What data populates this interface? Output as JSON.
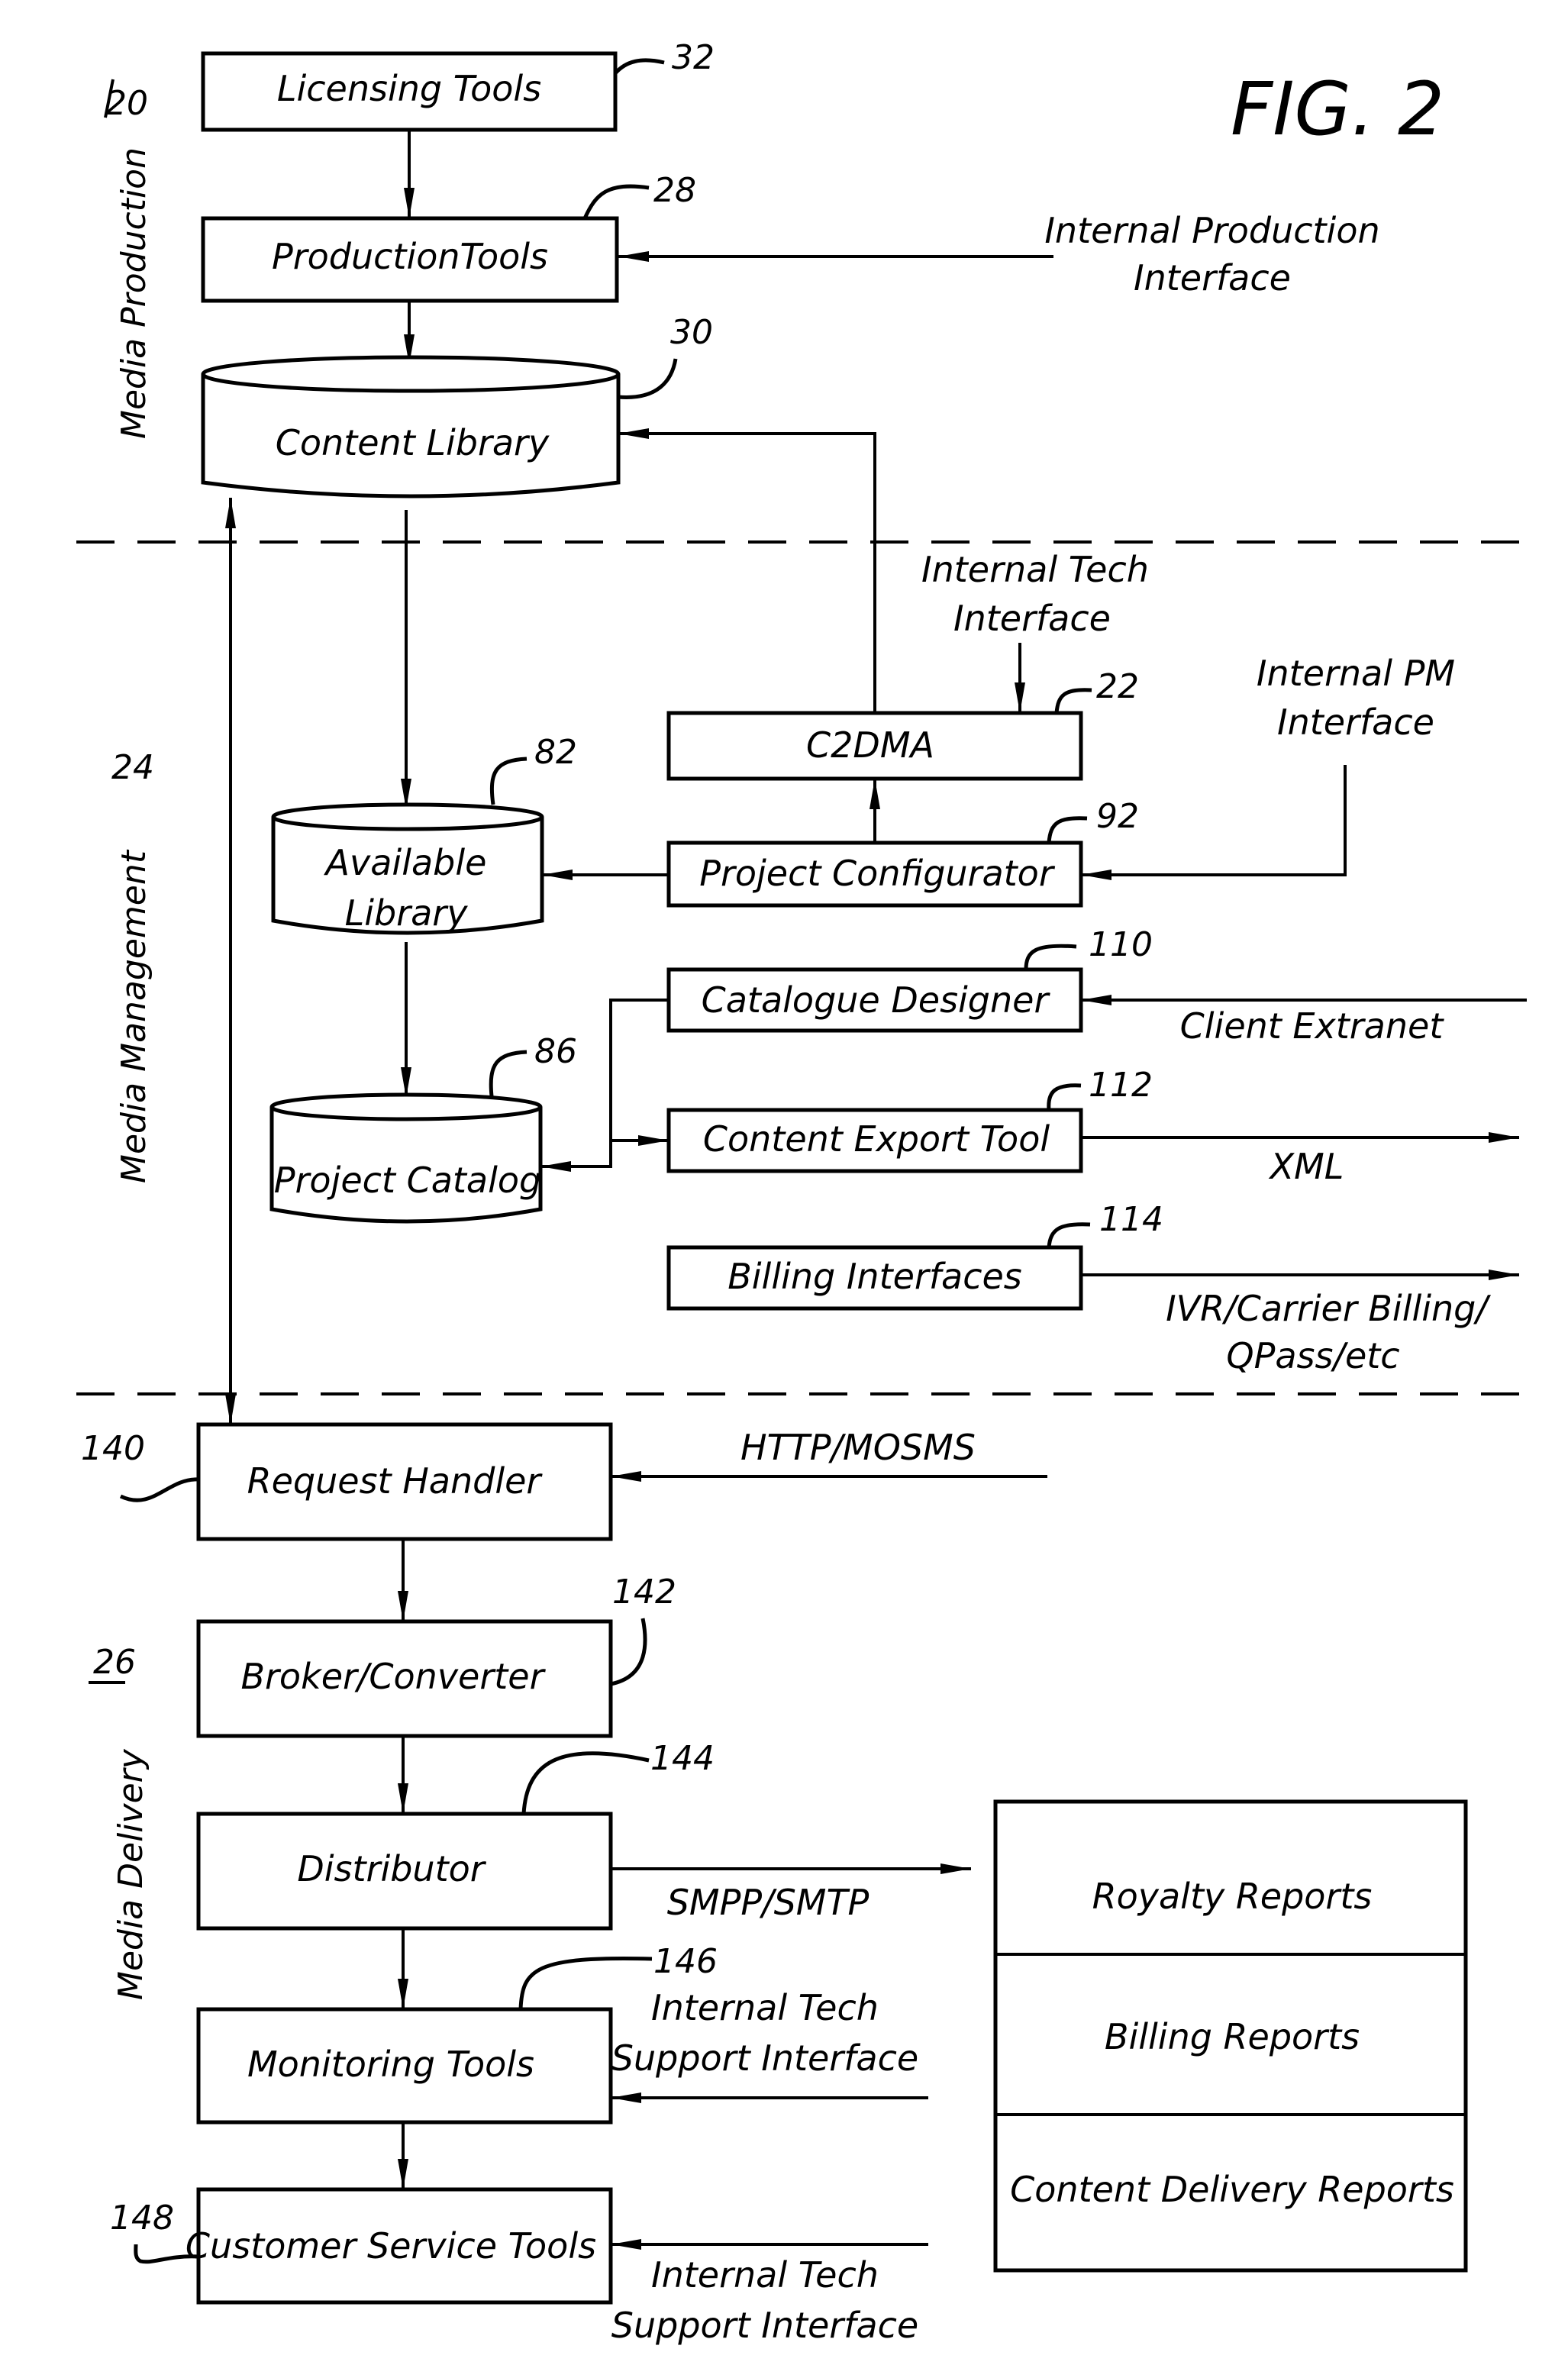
{
  "figure": {
    "title": "FIG. 2"
  },
  "sections": [
    {
      "id": "media-production",
      "label": "Media Production",
      "ref": "20"
    },
    {
      "id": "media-management",
      "label": "Media Management",
      "ref": "24"
    },
    {
      "id": "media-delivery",
      "label": "Media Delivery",
      "ref": "26"
    }
  ],
  "nodes": {
    "licensing_tools": {
      "label": "Licensing Tools",
      "ref": "32",
      "shape": "box"
    },
    "production_tools": {
      "label": "ProductionTools",
      "ref": "28",
      "shape": "box"
    },
    "content_library": {
      "label": "Content Library",
      "ref": "30",
      "shape": "cylinder"
    },
    "c2dma": {
      "label": "C2DMA",
      "ref": "22",
      "shape": "box"
    },
    "project_configurator": {
      "label": "Project Configurator",
      "ref": "92",
      "shape": "box"
    },
    "available_library": {
      "label_line1": "Available",
      "label_line2": "Library",
      "ref": "82",
      "shape": "cylinder"
    },
    "project_catalog": {
      "label": "Project Catalog",
      "ref": "86",
      "shape": "cylinder"
    },
    "catalogue_designer": {
      "label": "Catalogue Designer",
      "ref": "110",
      "shape": "box"
    },
    "content_export_tool": {
      "label": "Content Export Tool",
      "ref": "112",
      "shape": "box"
    },
    "billing_interfaces": {
      "label": "Billing Interfaces",
      "ref": "114",
      "shape": "box"
    },
    "request_handler": {
      "label": "Request Handler",
      "ref": "140",
      "shape": "box"
    },
    "broker_converter": {
      "label": "Broker/Converter",
      "ref": "142",
      "shape": "box"
    },
    "distributor": {
      "label": "Distributor",
      "ref": "144",
      "shape": "box"
    },
    "monitoring_tools": {
      "label": "Monitoring Tools",
      "ref": "146",
      "shape": "box"
    },
    "customer_service_tools": {
      "label": "Customer Service Tools",
      "ref": "148",
      "shape": "box"
    }
  },
  "reports": [
    "Royalty Reports",
    "Billing Reports",
    "Content Delivery Reports"
  ],
  "external_labels": {
    "internal_production_interface": [
      "Internal Production",
      "Interface"
    ],
    "internal_tech_interface": [
      "Internal Tech",
      "Interface"
    ],
    "internal_pm_interface": [
      "Internal PM",
      "Interface"
    ],
    "client_extranet": "Client Extranet",
    "xml": "XML",
    "billing_out": [
      "IVR/Carrier Billing/",
      "QPass/etc"
    ],
    "http_mosms": "HTTP/MOSMS",
    "smpp_smtp": "SMPP/SMTP",
    "monitoring_support": [
      "Internal Tech",
      "Support Interface"
    ],
    "cs_support": [
      "Internal Tech",
      "Support Interface"
    ]
  },
  "edges": [
    {
      "from": "licensing_tools",
      "to": "production_tools"
    },
    {
      "from": "internal_production_interface",
      "to": "production_tools"
    },
    {
      "from": "production_tools",
      "to": "content_library"
    },
    {
      "from": "c2dma",
      "to": "content_library"
    },
    {
      "from": "content_library",
      "to": "available_library"
    },
    {
      "from": "content_library",
      "to": "request_handler",
      "bidirectional": true
    },
    {
      "from": "internal_tech_interface",
      "to": "c2dma"
    },
    {
      "from": "project_configurator",
      "to": "c2dma"
    },
    {
      "from": "internal_pm_interface",
      "to": "project_configurator"
    },
    {
      "from": "project_configurator",
      "to": "available_library"
    },
    {
      "from": "available_library",
      "to": "project_catalog"
    },
    {
      "from": "catalogue_designer",
      "to": "project_catalog"
    },
    {
      "from": "catalogue_designer",
      "to": "content_export_tool"
    },
    {
      "from": "client_extranet",
      "to": "catalogue_designer"
    },
    {
      "from": "content_export_tool",
      "to": "xml"
    },
    {
      "from": "billing_interfaces",
      "to": "billing_out"
    },
    {
      "from": "http_mosms",
      "to": "request_handler"
    },
    {
      "from": "request_handler",
      "to": "broker_converter"
    },
    {
      "from": "broker_converter",
      "to": "distributor"
    },
    {
      "from": "distributor",
      "to": "smpp_smtp"
    },
    {
      "from": "distributor",
      "to": "monitoring_tools"
    },
    {
      "from": "monitoring_support",
      "to": "monitoring_tools"
    },
    {
      "from": "monitoring_tools",
      "to": "customer_service_tools"
    },
    {
      "from": "cs_support",
      "to": "customer_service_tools"
    }
  ]
}
